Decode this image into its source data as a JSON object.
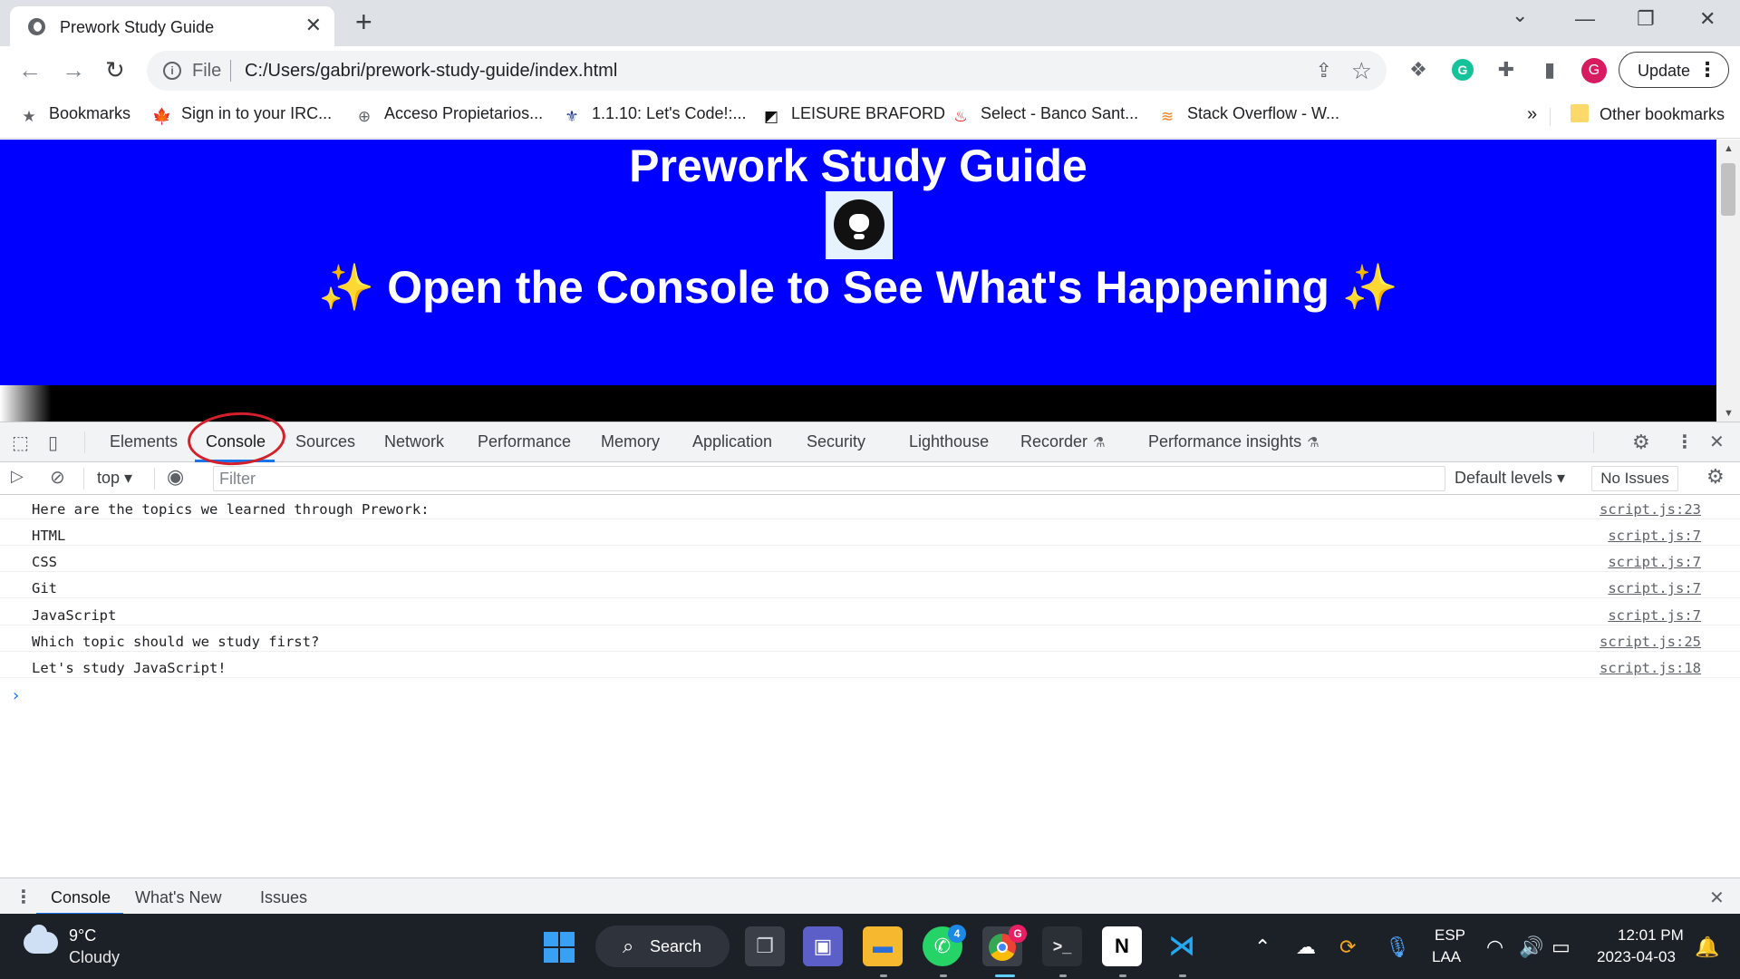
{
  "browser": {
    "tab_title": "Prework Study Guide",
    "tab_close": "✕",
    "new_tab": "+",
    "window_controls": {
      "dropdown": "⌄",
      "minimize": "—",
      "restore": "❐",
      "close": "✕"
    }
  },
  "omnibox": {
    "scheme": "File",
    "url": "C:/Users/gabri/prework-study-guide/index.html"
  },
  "profile": {
    "initial": "G"
  },
  "update_button": {
    "label": "Update"
  },
  "bookmarks": {
    "items": [
      {
        "label": "Bookmarks",
        "icon": "★"
      },
      {
        "label": "Sign in to your IRC...",
        "icon": "🍁"
      },
      {
        "label": "Acceso Propietarios...",
        "icon": "⊕"
      },
      {
        "label": "1.1.10: Let's Code!:...",
        "icon": "⚜"
      },
      {
        "label": "LEISURE BRAFORD",
        "icon": "◩"
      },
      {
        "label": "Select - Banco Sant...",
        "icon": "♨"
      },
      {
        "label": "Stack Overflow - W...",
        "icon": "≋"
      }
    ],
    "overflow": "»",
    "other": "Other bookmarks"
  },
  "page": {
    "title": "Prework Study Guide",
    "subtitle_sparkle": "✨",
    "subtitle": "Open the Console to See What's Happening",
    "colors": {
      "hero_bg": "#0000ff",
      "text": "#ffffff"
    }
  },
  "devtools": {
    "tabs": [
      "Elements",
      "Console",
      "Sources",
      "Network",
      "Performance",
      "Memory",
      "Application",
      "Security",
      "Lighthouse",
      "Recorder",
      "Performance insights"
    ],
    "active_tab": "Console",
    "context": "top ▾",
    "filter_placeholder": "Filter",
    "levels": "Default levels ▾",
    "issues": "No Issues",
    "console_rows": [
      {
        "message": "Here are the topics we learned through Prework:",
        "source": "script.js:23"
      },
      {
        "message": "HTML",
        "source": "script.js:7"
      },
      {
        "message": "CSS",
        "source": "script.js:7"
      },
      {
        "message": "Git",
        "source": "script.js:7"
      },
      {
        "message": "JavaScript",
        "source": "script.js:7"
      },
      {
        "message": "Which topic should we study first?",
        "source": "script.js:25"
      },
      {
        "message": "Let's study JavaScript!",
        "source": "script.js:18"
      }
    ],
    "prompt": "›",
    "drawer_tabs": [
      "Console",
      "What's New",
      "Issues"
    ]
  },
  "taskbar": {
    "weather": {
      "temp": "9°C",
      "condition": "Cloudy"
    },
    "search_label": "Search",
    "whatsapp_badge": "4",
    "chrome_badge": "G",
    "language": {
      "line1": "ESP",
      "line2": "LAA"
    },
    "clock": {
      "time": "12:01 PM",
      "date": "2023-04-03"
    }
  }
}
